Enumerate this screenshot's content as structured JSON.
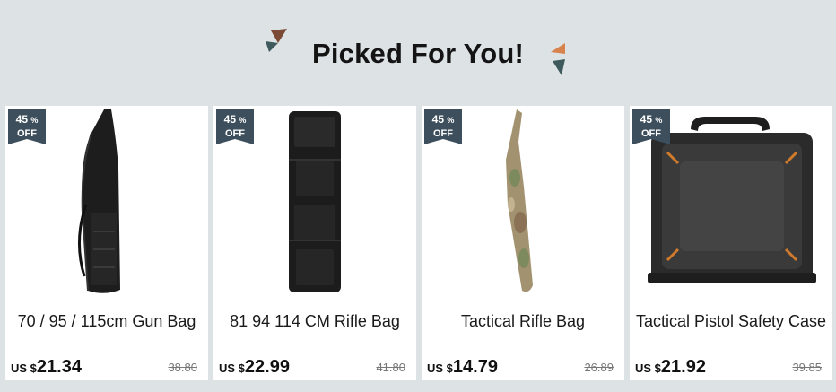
{
  "header": {
    "title": "Picked For You!",
    "deco_left_icon": "triangle-confetti-icon",
    "deco_right_icon": "triangle-confetti-icon"
  },
  "colors": {
    "badge_bg": "#3d4f5c",
    "deco_brown": "#7a4a34",
    "deco_orange": "#d7834e",
    "deco_teal": "#3f5a5c"
  },
  "products": [
    {
      "name": "70 / 95 / 115cm Gun Bag",
      "discount": "45",
      "discount_unit": "%",
      "off_label": "OFF",
      "currency": "US $",
      "price": "21.34",
      "old_price": "38.80",
      "image": "black-gun-bag"
    },
    {
      "name": "81 94 114 CM Rifle Bag",
      "discount": "45",
      "discount_unit": "%",
      "off_label": "OFF",
      "currency": "US $",
      "price": "22.99",
      "old_price": "41.80",
      "image": "black-rifle-bag"
    },
    {
      "name": "Tactical Rifle Bag",
      "discount": "45",
      "discount_unit": "%",
      "off_label": "OFF",
      "currency": "US $",
      "price": "14.79",
      "old_price": "26.89",
      "image": "camo-rifle-bag"
    },
    {
      "name": "Tactical Pistol Safety Case",
      "discount": "45",
      "discount_unit": "%",
      "off_label": "OFF",
      "currency": "US $",
      "price": "21.92",
      "old_price": "39.85",
      "image": "pistol-case"
    }
  ]
}
